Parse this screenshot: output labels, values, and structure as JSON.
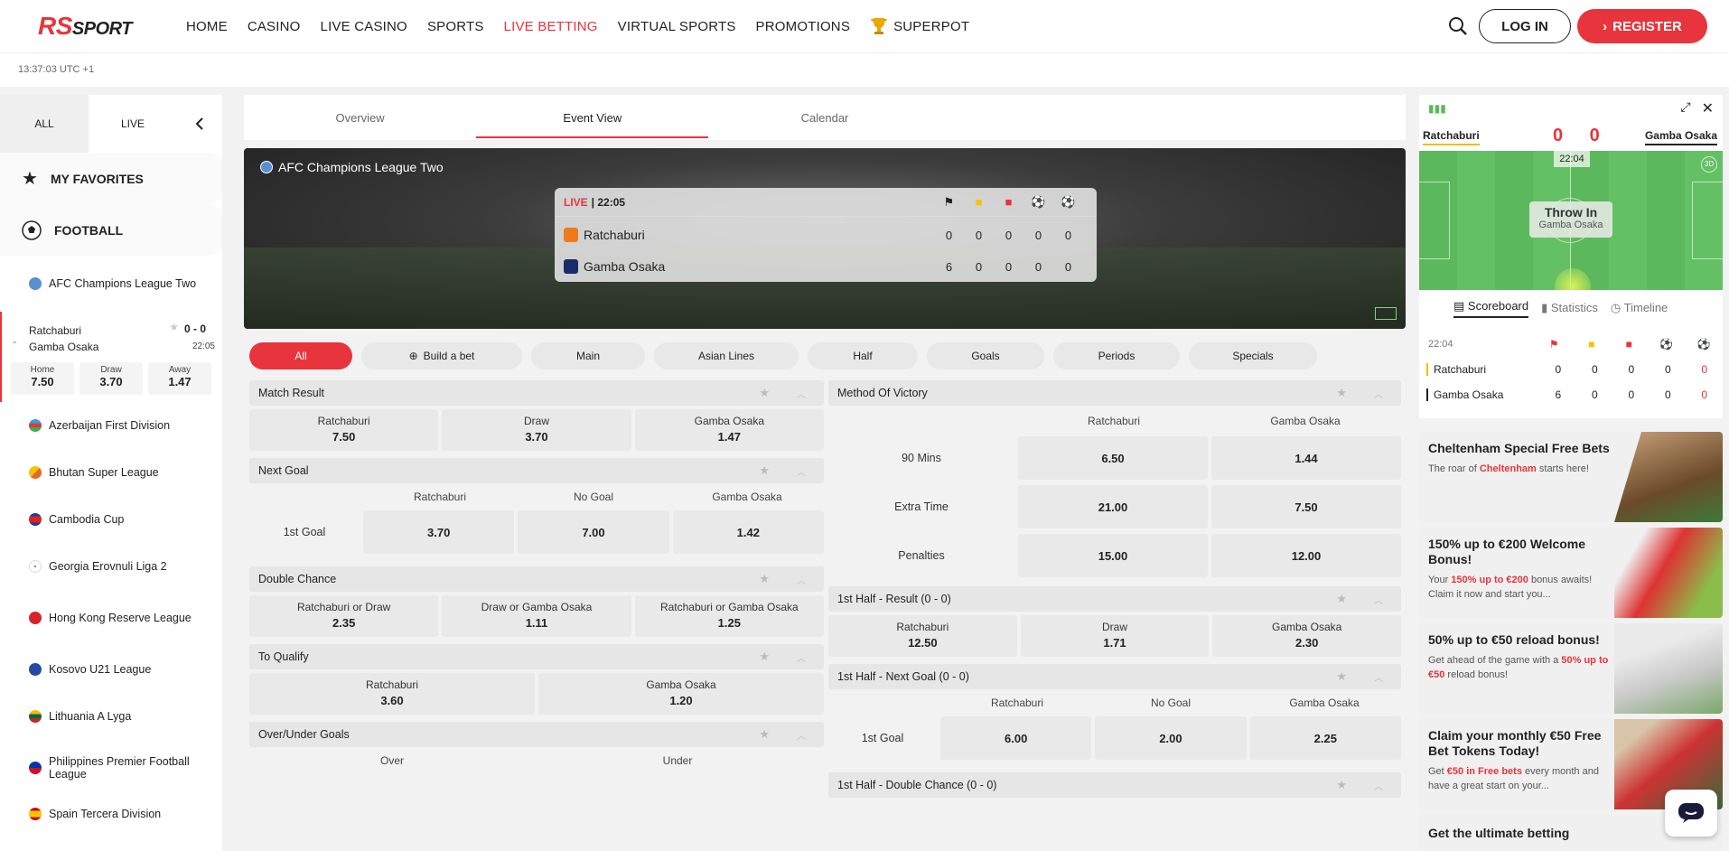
{
  "brand": {
    "r": "RS",
    "sport": "SPORT",
    "accent": "#e8343c"
  },
  "nav": [
    "HOME",
    "CASINO",
    "LIVE CASINO",
    "SPORTS",
    "LIVE BETTING",
    "VIRTUAL SPORTS",
    "PROMOTIONS",
    "SUPERPOT"
  ],
  "auth": {
    "login": "LOG IN",
    "register": "REGISTER"
  },
  "clock": "13:37:03 UTC +1",
  "sidebar": {
    "tabs": {
      "all": "ALL",
      "live": "LIVE"
    },
    "favorites": "MY FAVORITES",
    "football": "FOOTBALL",
    "leagues": [
      "AFC Champions League Two",
      "Azerbaijan First Division",
      "Bhutan Super League",
      "Cambodia Cup",
      "Georgia Erovnuli Liga 2",
      "Hong Kong Reserve League",
      "Kosovo U21 League",
      "Lithuania A Lyga",
      "Philippines Premier Football League",
      "Spain Tercera Division"
    ],
    "match": {
      "home": "Ratchaburi",
      "away": "Gamba Osaka",
      "score": "0 - 0",
      "time": "22:05",
      "odds": [
        {
          "label": "Home",
          "value": "7.50"
        },
        {
          "label": "Draw",
          "value": "3.70"
        },
        {
          "label": "Away",
          "value": "1.47"
        }
      ]
    }
  },
  "center": {
    "tabs": [
      "Overview",
      "Event View",
      "Calendar"
    ],
    "league": "AFC Champions League Two",
    "scoreboard": {
      "live": "LIVE",
      "time": "| 22:05",
      "teams": [
        {
          "name": "Ratchaburi",
          "nums": [
            "0",
            "0",
            "0",
            "0",
            "0"
          ]
        },
        {
          "name": "Gamba Osaka",
          "nums": [
            "6",
            "0",
            "0",
            "0",
            "0"
          ]
        }
      ]
    },
    "pills": [
      "All",
      "Build a bet",
      "Main",
      "Asian Lines",
      "Half",
      "Goals",
      "Periods",
      "Specials"
    ],
    "match_result": {
      "title": "Match Result",
      "odds": [
        {
          "l": "Ratchaburi",
          "v": "7.50"
        },
        {
          "l": "Draw",
          "v": "3.70"
        },
        {
          "l": "Gamba Osaka",
          "v": "1.47"
        }
      ]
    },
    "next_goal": {
      "title": "Next Goal",
      "cols": [
        "Ratchaburi",
        "No Goal",
        "Gamba Osaka"
      ],
      "row": "1st Goal",
      "vals": [
        "3.70",
        "7.00",
        "1.42"
      ]
    },
    "double_chance": {
      "title": "Double Chance",
      "odds": [
        {
          "l": "Ratchaburi or Draw",
          "v": "2.35"
        },
        {
          "l": "Draw or Gamba Osaka",
          "v": "1.11"
        },
        {
          "l": "Ratchaburi or Gamba Osaka",
          "v": "1.25"
        }
      ]
    },
    "to_qualify": {
      "title": "To Qualify",
      "odds": [
        {
          "l": "Ratchaburi",
          "v": "3.60"
        },
        {
          "l": "Gamba Osaka",
          "v": "1.20"
        }
      ]
    },
    "over_under": {
      "title": "Over/Under Goals",
      "cols": [
        "Over",
        "Under"
      ]
    },
    "method": {
      "title": "Method Of Victory",
      "cols": [
        "Ratchaburi",
        "Gamba Osaka"
      ],
      "rows": [
        {
          "l": "90 Mins",
          "a": "6.50",
          "b": "1.44"
        },
        {
          "l": "Extra Time",
          "a": "21.00",
          "b": "7.50"
        },
        {
          "l": "Penalties",
          "a": "15.00",
          "b": "12.00"
        }
      ]
    },
    "half_result": {
      "title": "1st Half - Result  (0 - 0)",
      "odds": [
        {
          "l": "Ratchaburi",
          "v": "12.50"
        },
        {
          "l": "Draw",
          "v": "1.71"
        },
        {
          "l": "Gamba Osaka",
          "v": "2.30"
        }
      ]
    },
    "half_next_goal": {
      "title": "1st Half - Next Goal  (0 - 0)",
      "cols": [
        "Ratchaburi",
        "No Goal",
        "Gamba Osaka"
      ],
      "row": "1st Goal",
      "vals": [
        "6.00",
        "2.00",
        "2.25"
      ]
    },
    "half_double": {
      "title": "1st Half - Double Chance  (0 - 0)"
    }
  },
  "right": {
    "home": "Ratchaburi",
    "away": "Gamba Osaka",
    "score": "0 0",
    "clock": "22:04",
    "event": "Throw In",
    "event_team": "Gamba Osaka",
    "tabs": [
      "Scoreboard",
      "Statistics",
      "Timeline"
    ],
    "stat_time": "22:04",
    "rows": [
      {
        "name": "Ratchaburi",
        "nums": [
          "0",
          "0",
          "0",
          "0",
          "0"
        ]
      },
      {
        "name": "Gamba Osaka",
        "nums": [
          "6",
          "0",
          "0",
          "0",
          "0"
        ]
      }
    ]
  },
  "promos": [
    {
      "title": "Cheltenham Special Free Bets",
      "pre": "The roar of ",
      "hl": "Cheltenham",
      "post": " starts here!"
    },
    {
      "title": "150% up to €200 Welcome Bonus!",
      "pre": "Your ",
      "hl": "150% up to €200",
      "post": " bonus awaits! Claim it now and start you..."
    },
    {
      "title": "50% up to €50 reload bonus!",
      "pre": "Get ahead of the game with a ",
      "hl": "50% up to €50",
      "post": " reload bonus!"
    },
    {
      "title": "Claim your monthly €50 Free Bet Tokens Today!",
      "pre": "Get ",
      "hl": "€50 in Free bets",
      "post": " every month and have a great start on your..."
    },
    {
      "title": "Get the ultimate betting",
      "pre": "",
      "hl": "",
      "post": ""
    }
  ]
}
